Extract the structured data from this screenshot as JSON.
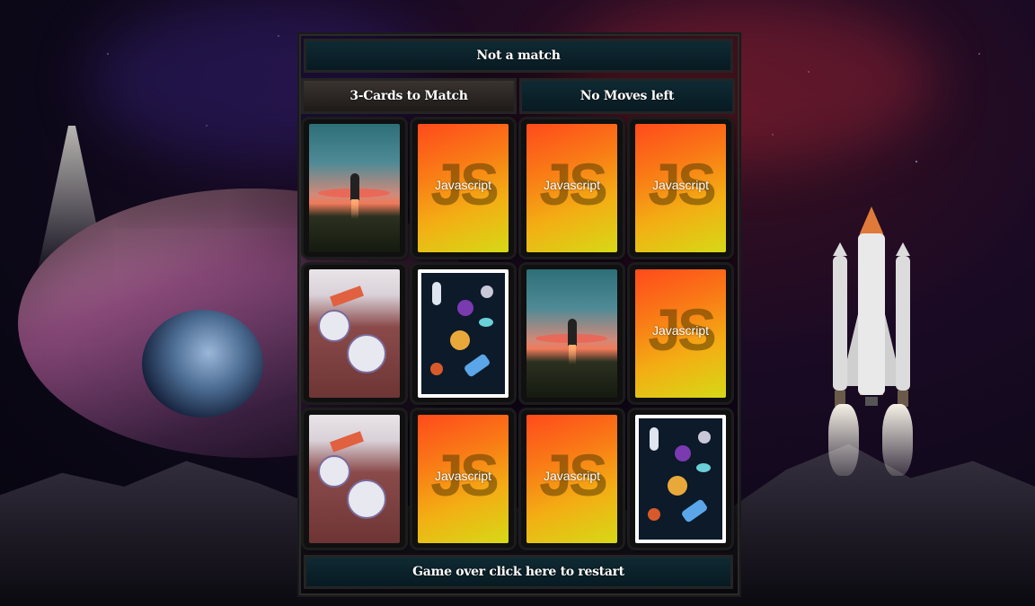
{
  "status": {
    "message": "Not a match"
  },
  "mode": {
    "label": "3-Cards to Match"
  },
  "moves": {
    "label": "No Moves left"
  },
  "footer": {
    "restart_label": "Game over click here to restart"
  },
  "card_back": {
    "logo": "JS",
    "label": "Javascript"
  },
  "cards": [
    {
      "state": "face-up",
      "image": "rocket-launch"
    },
    {
      "state": "face-down",
      "image": "javascript-back"
    },
    {
      "state": "face-down",
      "image": "javascript-back"
    },
    {
      "state": "face-down",
      "image": "javascript-back"
    },
    {
      "state": "face-up",
      "image": "astronauts"
    },
    {
      "state": "face-up",
      "image": "space-icons"
    },
    {
      "state": "face-up",
      "image": "rocket-launch"
    },
    {
      "state": "face-down",
      "image": "javascript-back"
    },
    {
      "state": "face-up",
      "image": "astronauts"
    },
    {
      "state": "face-down",
      "image": "javascript-back"
    },
    {
      "state": "face-down",
      "image": "javascript-back"
    },
    {
      "state": "face-up",
      "image": "space-icons"
    }
  ],
  "colors": {
    "card_back_top": "#ff4a1c",
    "card_back_bottom": "#d6d916",
    "bar_bg": "#0f2a33"
  }
}
